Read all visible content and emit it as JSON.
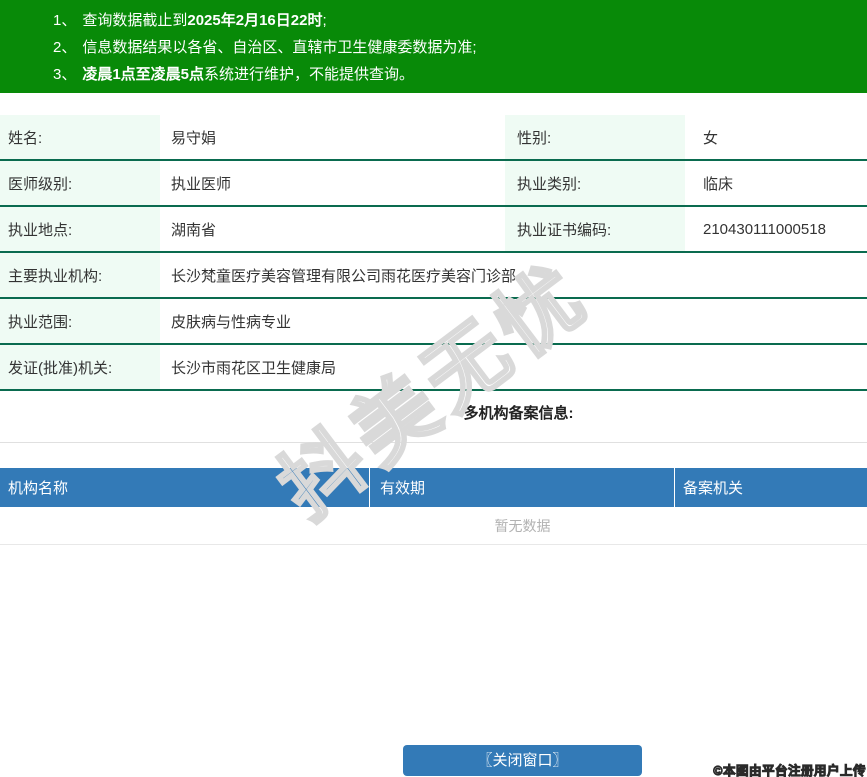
{
  "notice": {
    "bg_color": "#088a08",
    "items": [
      {
        "num": "1、",
        "pre": "查询数据截止到",
        "bold": "2025年2月16日22时",
        "post": ";"
      },
      {
        "num": "2、",
        "pre": "信息数据结果以各省、自治区、直辖市卫生健康委数据为准;",
        "bold": "",
        "post": ""
      },
      {
        "num": "3、",
        "pre": "",
        "bold": "凌晨1点至凌晨5点",
        "post": "系统进行维护，不能提供查询。"
      }
    ]
  },
  "info": {
    "label_bg": "#effbf4",
    "row_border_color": "#0a6b4f",
    "rows2col": [
      {
        "l1": "姓名:",
        "v1": "易守娟",
        "l2": "性别:",
        "v2": "女"
      },
      {
        "l1": "医师级别:",
        "v1": "执业医师",
        "l2": "执业类别:",
        "v2": "临床"
      },
      {
        "l1": "执业地点:",
        "v1": "湖南省",
        "l2": "执业证书编码:",
        "v2": "210430111000518"
      }
    ],
    "rows1col": [
      {
        "l": "主要执业机构:",
        "v": "长沙梵童医疗美容管理有限公司雨花医疗美容门诊部"
      },
      {
        "l": "执业范围:",
        "v": "皮肤病与性病专业"
      },
      {
        "l": "发证(批准)机关:",
        "v": "长沙市雨花区卫生健康局"
      }
    ]
  },
  "backup": {
    "heading": "多机构备案信息:",
    "header_bg": "#337ab7",
    "columns": [
      "机构名称",
      "有效期",
      "备案机关"
    ],
    "empty_text": "暂无数据"
  },
  "watermark": "抖美无忧",
  "footer": {
    "close_button": "〖关闭窗口〗",
    "button_color": "#337ab7",
    "copyright": "©本图由平台注册用户上传"
  }
}
